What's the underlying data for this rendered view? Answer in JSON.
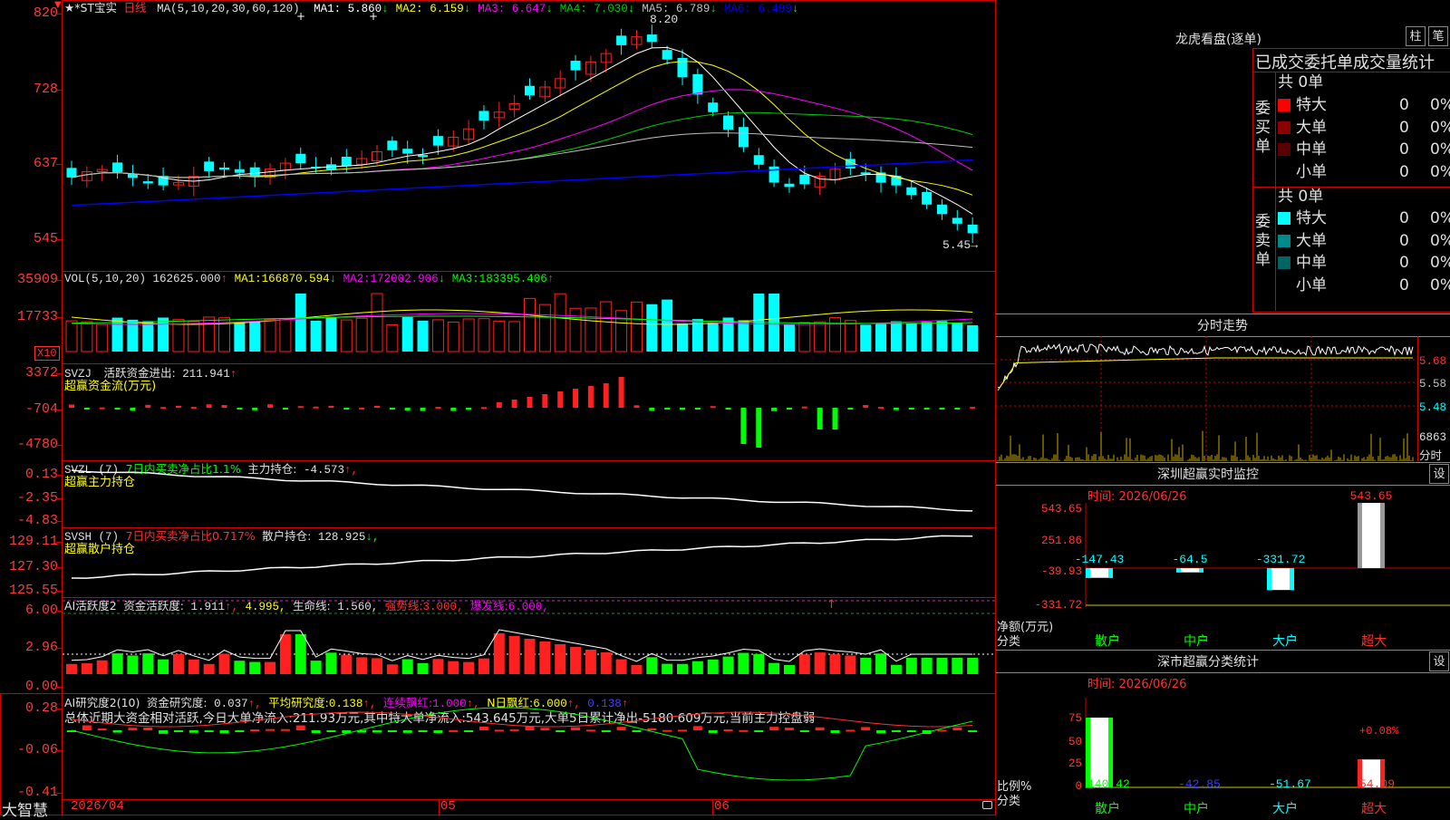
{
  "colors": {
    "up": "#ff2020",
    "down": "#00ffff",
    "frame": "#d00000",
    "ma1": "#ffffff",
    "ma2": "#ffff00",
    "ma3": "#ff00ff",
    "ma4": "#00cc00",
    "ma5": "#c0c0c0",
    "ma6": "#0000ff"
  },
  "kline": {
    "title": "★*ST宝实",
    "period": "日线",
    "ma_name": "MA(5,10,20,30,60,120)",
    "ma": [
      {
        "label": "MA1:",
        "value": "5.860",
        "arrow": "↓",
        "color": "#ffffff"
      },
      {
        "label": "MA2:",
        "value": "6.159",
        "arrow": "↓",
        "color": "#ffff00"
      },
      {
        "label": "MA3:",
        "value": "6.647",
        "arrow": "↓",
        "color": "#ff00ff"
      },
      {
        "label": "MA4:",
        "value": "7.030",
        "arrow": "↓",
        "color": "#00cc00"
      },
      {
        "label": "MA5:",
        "value": "6.789",
        "arrow": "↓",
        "color": "#c0c0c0"
      },
      {
        "label": "MA6:",
        "value": "6.499",
        "arrow": "↓",
        "color": "#0000ff"
      }
    ],
    "y_ticks": [
      "820",
      "728",
      "637",
      "545"
    ],
    "high_label": "8.20",
    "low_label": "5.45→"
  },
  "vol": {
    "name": "VOL(5,10,20)",
    "value": "162625.000",
    "arrow": "↑",
    "ma1_label": "MA1:",
    "ma1": "166870.594",
    "ma1_arrow": "↓",
    "ma2_label": "MA2:",
    "ma2": "172002.906",
    "ma2_arrow": "↓",
    "ma3_label": "MA3:",
    "ma3": "183395.406",
    "ma3_arrow": "↑",
    "y_ticks": [
      "35909",
      "17733"
    ],
    "unit": "X10"
  },
  "svzj": {
    "name": "SVZJ",
    "desc": "活跃资金进出:",
    "value": "211.941",
    "arrow": "↑",
    "sub": "超赢资金流(万元)",
    "y_ticks": [
      "3372",
      "-704",
      "-4780"
    ]
  },
  "svzl": {
    "name": "SVZL (7)",
    "desc": "7日内买卖净占比1.1%",
    "desc2": "主力持仓:",
    "value": "-4.573",
    "arrow": "↑,",
    "sub": "超赢主力持仓",
    "y_ticks": [
      "0.13",
      "-2.35",
      "-4.83"
    ]
  },
  "svsh": {
    "name": "SVSH (7)",
    "desc": "7日内买卖净占比0.717%",
    "desc2": "散户持仓:",
    "value": "128.925",
    "arrow": "↓,",
    "sub": "超赢散户持仓",
    "y_ticks": [
      "129.11",
      "127.30",
      "125.55"
    ]
  },
  "ai1": {
    "name": "AI活跃度2",
    "desc": "资金活跃度:",
    "value": "1.911",
    "arrow": "↑,",
    "v2": "4.995,",
    "desc3": "生命线:",
    "v3": "1.560,",
    "strong": "强势线:",
    "strong_v": "3.000,",
    "burst": "爆发线:",
    "burst_v": "6.000,",
    "mark": "↑",
    "y_ticks": [
      "6.00",
      "2.96",
      "0.00"
    ]
  },
  "ai2": {
    "name": "AI研究度2(10)",
    "desc": "资金研究度:",
    "value": "0.037",
    "arrow": "↑,",
    "avg": "平均研究度:",
    "avg_v": "0.138",
    "avg_arrow": "↑,",
    "lx": "连续飘红:",
    "lx_v": "1.000",
    "lx_arrow": "↑,",
    "nr": "N日飘红:",
    "nr_v": "6.000",
    "nr_arrow": "↑,",
    "extra": "0.138",
    "extra_arrow": "↑",
    "summary": "总体近期大资金相对活跃,今日大单净流入:211.93万元,其中特大单净流入:543.645万元,大单5日累计净出-5180.609万元,当前主力控盘弱",
    "y_ticks": [
      "0.28",
      "-0.06",
      "-0.41"
    ]
  },
  "xaxis": {
    "labels": [
      "2026/04",
      "05",
      "06"
    ]
  },
  "brand": "大智慧",
  "right": {
    "lhb_title": "龙虎看盘(逐单)",
    "btn_bar": "柱",
    "btn_pen": "笔",
    "stat_title": "已成交委托单成交量统计",
    "buy": {
      "side": "委买单",
      "total": "共 0单",
      "rows": [
        {
          "name": "特大",
          "val": "0",
          "pct": "0%",
          "color": "#ff0000"
        },
        {
          "name": "大单",
          "val": "0",
          "pct": "0%",
          "color": "#8b0000"
        },
        {
          "name": "中单",
          "val": "0",
          "pct": "0%",
          "color": "#5a0000"
        },
        {
          "name": "小单",
          "val": "0",
          "pct": "0%",
          "color": "#000000"
        }
      ]
    },
    "sell": {
      "side": "委卖单",
      "total": "共 0单",
      "rows": [
        {
          "name": "特大",
          "val": "0",
          "pct": "0%",
          "color": "#00ffff"
        },
        {
          "name": "大单",
          "val": "0",
          "pct": "0%",
          "color": "#008b8b"
        },
        {
          "name": "中单",
          "val": "0",
          "pct": "0%",
          "color": "#006464"
        },
        {
          "name": "小单",
          "val": "0",
          "pct": "0%",
          "color": "#000000"
        }
      ]
    },
    "intraday_title": "分时走势",
    "intraday_prices": [
      "5.68",
      "5.58",
      "5.48"
    ],
    "intraday_vol": "6863",
    "intraday_vol_unit": "分时",
    "sz_title": "深圳超赢实时监控",
    "btn_set": "设",
    "date_label": "时间: 2026/06/26",
    "monitor": {
      "y_ticks": [
        "543.65",
        "251.86",
        "-39.93",
        "-331.72"
      ],
      "unit": "净额(万元)",
      "cat_label": "分类",
      "categories": [
        "散户",
        "中户",
        "大户",
        "超大"
      ],
      "values": [
        "-147.43",
        "-64.5",
        "-331.72",
        "543.65"
      ]
    },
    "sc_title": "深市超赢分类统计",
    "class_stat": {
      "y_ticks": [
        "75",
        "50",
        "25",
        "0"
      ],
      "unit": "比例%",
      "cat_label": "分类",
      "pct_label": "+0.08%",
      "categories": [
        "散户",
        "中户",
        "大户",
        "超大"
      ],
      "values": [
        "140.42",
        "-42.85",
        "-51.67",
        "54.09"
      ]
    }
  }
}
